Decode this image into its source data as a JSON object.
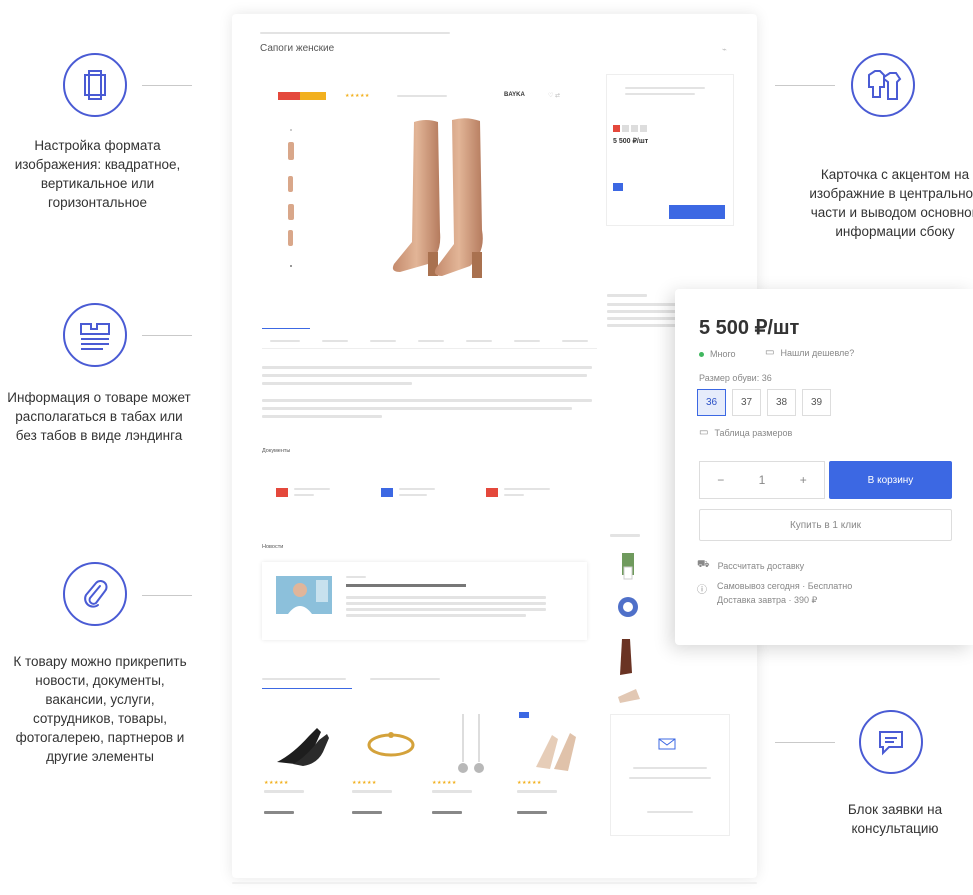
{
  "features": {
    "format": {
      "text": "Настройка формата изображения: квадратное, вертикальное или горизонтальное",
      "icon": "crop-frame-icon"
    },
    "info": {
      "text": "Информация о товаре может располагаться в табах или без табов в виде лэндинга",
      "icon": "landing-layout-icon"
    },
    "attach": {
      "text": "К товару можно прикрепить новости, документы, вакансии, услуги, сотрудников, товары, фотогалерею, партнеров и другие элементы",
      "icon": "paperclip-icon"
    },
    "card": {
      "text": "Карточка с акцентом на изображние в центральной части и выводом основной информации сбоку",
      "icon": "clothing-icon"
    },
    "consult": {
      "text": "Блок заявки на консультацию",
      "icon": "chat-icon"
    }
  },
  "product_page": {
    "title": "Сапоги женские",
    "sections": {
      "documents": "Документы",
      "news": "Новости"
    },
    "side_price": "5 500 ₽/шт",
    "brand": "BAYKA"
  },
  "popup": {
    "price": "5 500 ₽/шт",
    "stock": "Много",
    "cheaper": "Нашли дешевле?",
    "size_label": "Размер обуви: 36",
    "sizes": [
      "36",
      "37",
      "38",
      "39"
    ],
    "size_table": "Таблица размеров",
    "qty_minus": "−",
    "qty_value": "1",
    "qty_plus": "+",
    "cart_button": "В корзину",
    "one_click": "Купить в 1 клик",
    "delivery_calc": "Рассчитать доставку",
    "delivery_info_1": "Самовывоз сегодня · Бесплатно",
    "delivery_info_2": "Доставка завтра · 390 ₽"
  },
  "colors": {
    "accent": "#3c68e3",
    "icon_stroke": "#4a5bd4"
  }
}
